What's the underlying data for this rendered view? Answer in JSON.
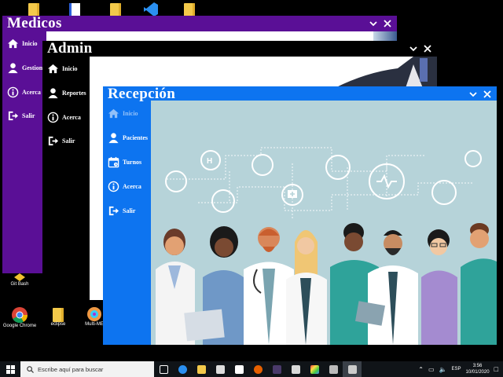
{
  "desktop": {
    "icons": [
      {
        "label": "Git Bash"
      },
      {
        "label": "Google Chrome"
      },
      {
        "label": "eclipse"
      },
      {
        "label": "Multi-ME"
      }
    ]
  },
  "windows": {
    "medicos": {
      "title": "Medicos",
      "sidebar": [
        "Inicio",
        "Gestion",
        "Acerca",
        "Salir"
      ]
    },
    "admin": {
      "title": "Admin",
      "sidebar": [
        "Inicio",
        "Reportes",
        "Acerca",
        "Salir"
      ]
    },
    "recepcion": {
      "title": "Recepción",
      "sidebar": [
        "Inicio",
        "Pacientes",
        "Turnos",
        "Acerca",
        "Salir"
      ]
    }
  },
  "taskbar": {
    "search_placeholder": "Escribe aquí para buscar",
    "language": "ESP",
    "time": "3:56",
    "date": "10/01/2020"
  },
  "colors": {
    "medicos": "#5a0f96",
    "admin": "#000000",
    "recepcion": "#0d74f0",
    "illustration_bg": "#b6d3d9"
  },
  "icons": [
    "home-icon",
    "user-icon",
    "info-icon",
    "exit-icon",
    "calendar-icon",
    "minimize-icon",
    "close-icon",
    "windows-start-icon",
    "search-icon"
  ]
}
